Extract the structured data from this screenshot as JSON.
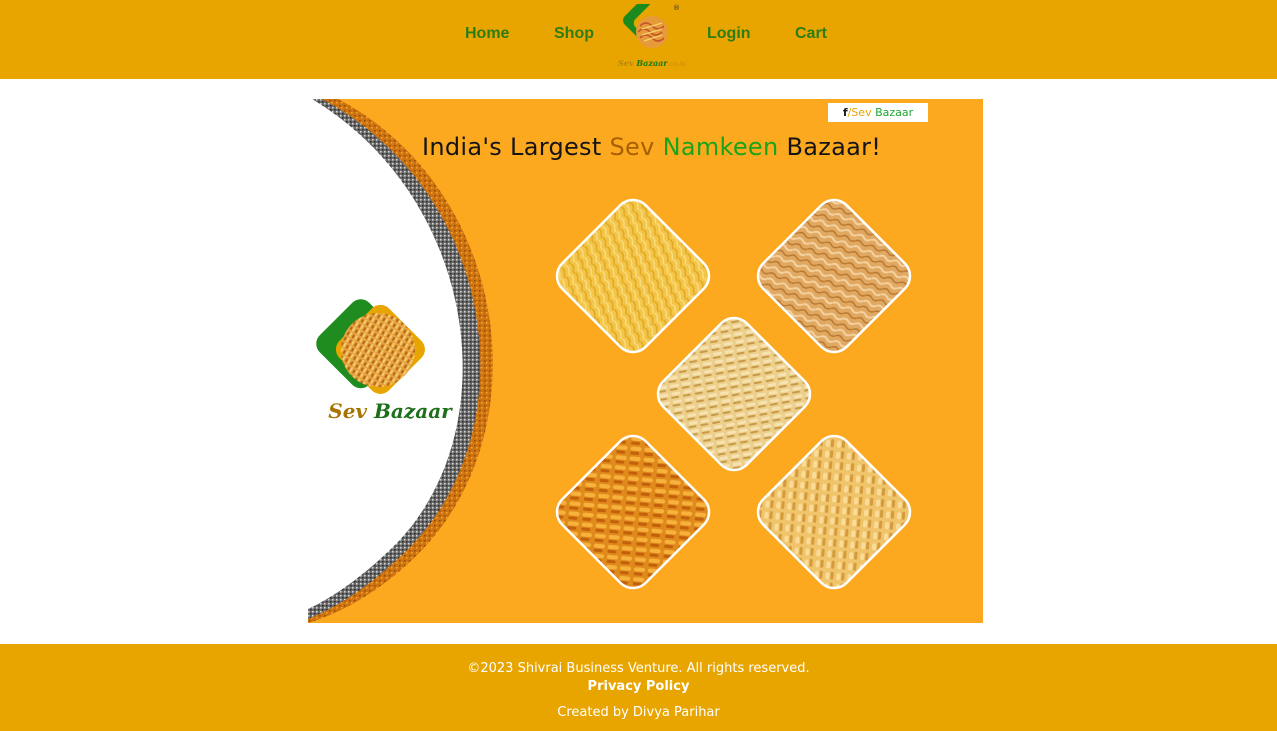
{
  "nav": {
    "items": [
      {
        "label": "Home"
      },
      {
        "label": "Shop"
      },
      {
        "label": "Login"
      },
      {
        "label": "Cart"
      }
    ],
    "logo": {
      "word1": "Sev",
      "word2": "Bazaar",
      "suffix": ".co.in",
      "mark": "®"
    }
  },
  "banner": {
    "fb_tag": {
      "icon": "f",
      "slash": "/",
      "word1": "Sev",
      "word2": "Bazaar"
    },
    "headline": {
      "part1": "India's Largest",
      "part2": "Sev",
      "part3": "Namkeen",
      "part4": "Bazaar!"
    },
    "brand": {
      "word1": "Sev",
      "word2": "Bazaar"
    }
  },
  "footer": {
    "copyright": "©2023 Shivrai Business Venture. All rights reserved.",
    "privacy": "Privacy Policy",
    "credit": "Created by Divya Parihar"
  },
  "colors": {
    "header_bg": "#e8a500",
    "nav_text": "#2d7d14",
    "banner_bg": "#fda920",
    "accent_green": "#18a518",
    "accent_brown": "#a85f00"
  }
}
